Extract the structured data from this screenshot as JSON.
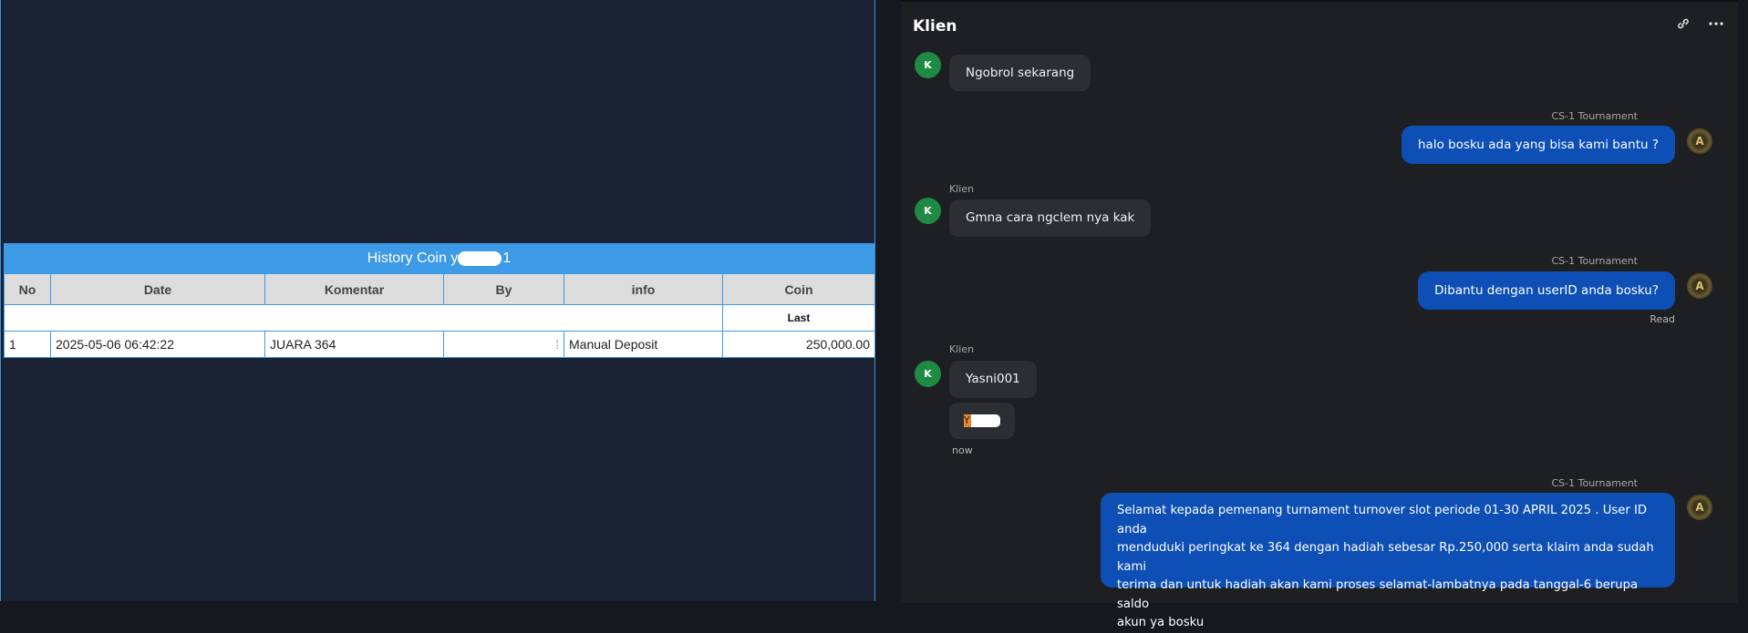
{
  "history": {
    "title_prefix": "History Coin y",
    "title_suffix": "1",
    "columns": [
      "No",
      "Date",
      "Komentar",
      "By",
      "info",
      "Coin"
    ],
    "sub_label": "Last",
    "rows": [
      {
        "no": "1",
        "date": "2025-05-06 06:42:22",
        "komentar": "JUARA 364",
        "by": "",
        "info": "Manual Deposit",
        "coin": "250,000.00"
      }
    ]
  },
  "chat": {
    "title": "Klien",
    "client_avatar_letter": "K",
    "agent_avatar_letter": "A",
    "messages": [
      {
        "from": "client",
        "text": "Ngobrol sekarang"
      },
      {
        "from": "agent",
        "sender": "CS-1 Tournament",
        "text": "halo bosku ada yang bisa kami bantu ?"
      },
      {
        "from": "client",
        "sender": "Klien",
        "text": "Gmna cara ngclem nya kak"
      },
      {
        "from": "agent",
        "sender": "CS-1 Tournament",
        "text": "Dibantu dengan userID anda bosku?",
        "status": "Read"
      },
      {
        "from": "client",
        "sender": "Klien",
        "text": "Yasni001"
      },
      {
        "from": "client",
        "text": "Y",
        "time": "now"
      },
      {
        "from": "agent",
        "sender": "CS-1 Tournament",
        "text_lines": [
          "Selamat kepada pemenang turnament turnover slot periode 01-30 APRIL 2025 . User ID anda",
          "menduduki peringkat ke 364 dengan hadiah sebesar Rp.250,000 serta klaim anda sudah kami",
          "terima dan untuk hadiah akan kami proses selamat-lambatnya pada tanggal-6 berupa saldo",
          "akun ya bosku"
        ]
      }
    ]
  },
  "icons": {
    "link": "link-icon",
    "more": "more-options-icon"
  }
}
